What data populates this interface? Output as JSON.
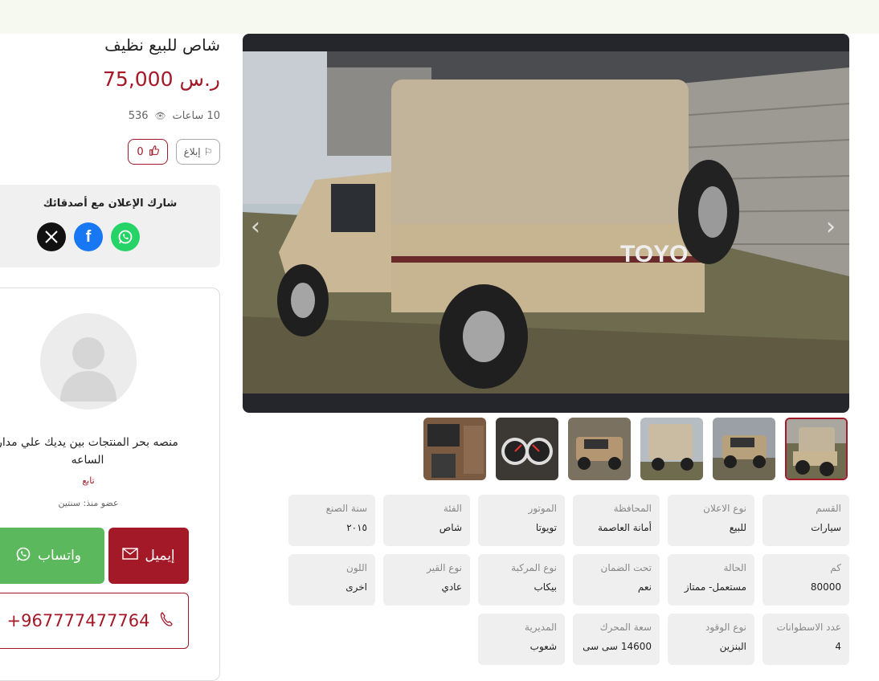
{
  "listing": {
    "title": "شاص للبيع نظيف",
    "price": "75,000 ر.س",
    "time_ago": "10 ساعات",
    "views": "536",
    "report_label": "إبلاغ",
    "likes": "0"
  },
  "share": {
    "title": "شارك الإعلان مع أصدقائك",
    "icons": [
      "x-icon",
      "facebook-icon",
      "whatsapp-icon"
    ]
  },
  "seller": {
    "name": "منصه بحر المنتجات بين يديك علي مدار الساعه",
    "follow_label": "تابع",
    "member_since": "عضو منذ: سنتين",
    "email_label": "إيميل",
    "whatsapp_label": "واتساب",
    "phone": "+967777477764"
  },
  "gallery": {
    "thumbnails": [
      "pickup-rear",
      "pickup-front",
      "pickup-canopy",
      "pickup-front-2",
      "dashboard",
      "interior"
    ],
    "active_index": 0
  },
  "specs": {
    "row1": [
      {
        "label": "القسم",
        "value": "سيارات"
      },
      {
        "label": "نوع الاعلان",
        "value": "للبيع"
      },
      {
        "label": "المحافظة",
        "value": "أمانة العاصمة"
      },
      {
        "label": "الموتور",
        "value": "تويوتا"
      },
      {
        "label": "الفئة",
        "value": "شاص"
      },
      {
        "label": "سنة الصنع",
        "value": "٢٠١٥"
      }
    ],
    "row2": [
      {
        "label": "كم",
        "value": "80000"
      },
      {
        "label": "الحالة",
        "value": "مستعمل- ممتاز"
      },
      {
        "label": "تحت الضمان",
        "value": "نعم"
      },
      {
        "label": "نوع المركبة",
        "value": "بيكاب"
      },
      {
        "label": "نوع القير",
        "value": "عادي"
      },
      {
        "label": "اللون",
        "value": "اخرى"
      }
    ],
    "row3": [
      {
        "label": "عدد الاسطوانات",
        "value": "4"
      },
      {
        "label": "نوع الوقود",
        "value": "البنزين"
      },
      {
        "label": "سعة المحرك",
        "value": "14600 سى سى"
      },
      {
        "label": "المديرية",
        "value": "شعوب"
      }
    ]
  },
  "colors": {
    "accent": "#a31928",
    "whatsapp": "#5cb85c",
    "spec_bg": "#efefef"
  }
}
